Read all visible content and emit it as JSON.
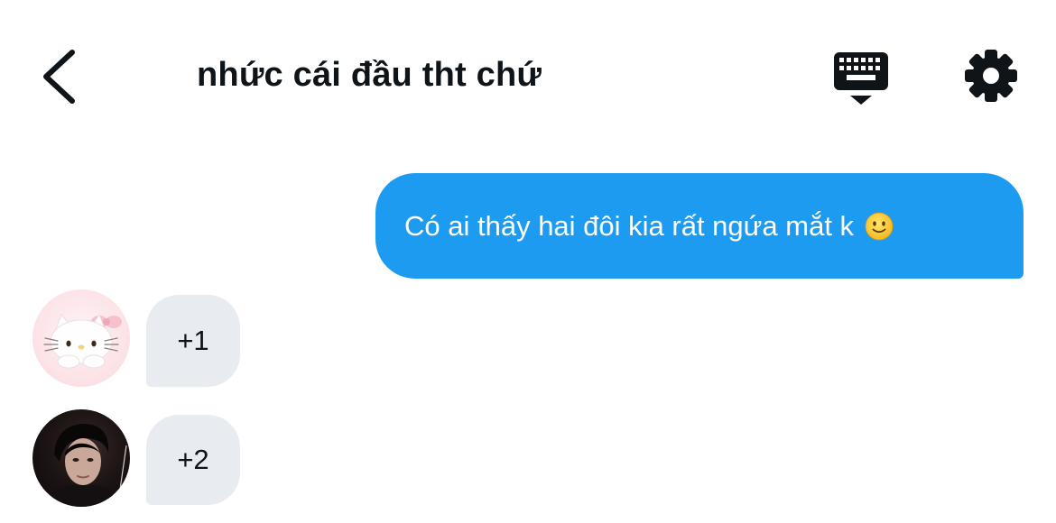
{
  "header": {
    "title": "nhức cái đầu tht chứ",
    "back_icon": "chevron-left-icon",
    "keyboard_icon": "keyboard-icon",
    "settings_icon": "gear-icon"
  },
  "messages": {
    "outgoing": {
      "text": "Có ai thấy hai đôi kia rất ngứa mắt k",
      "emoji": "slightly-smiling-face-icon",
      "bubble_color": "#1d9bf0"
    },
    "incoming": [
      {
        "avatar": "hello-kitty-avatar",
        "text": "+1"
      },
      {
        "avatar": "person-avatar",
        "text": "+2"
      }
    ]
  },
  "colors": {
    "accent": "#1d9bf0",
    "incoming_bubble": "#e8ebef",
    "text": "#0f1419"
  }
}
